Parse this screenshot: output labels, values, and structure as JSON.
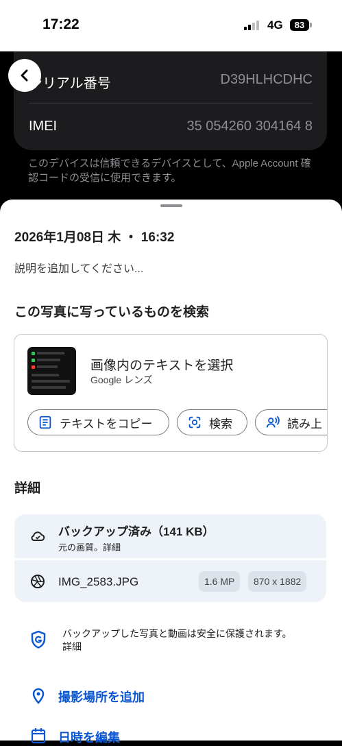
{
  "status_bar": {
    "time": "17:22",
    "network": "4G",
    "battery": "83"
  },
  "background_settings": {
    "rows": [
      {
        "label": "シリアル番号",
        "value": "D39HLHCDHC"
      },
      {
        "label": "IMEI",
        "value": "35 054260 304164 8"
      }
    ],
    "note": "このデバイスは信頼できるデバイスとして、Apple Account 確認コードの受信に使用できます。"
  },
  "sheet": {
    "date": "2026年1月08日 木 ・ 16:32",
    "description_placeholder": "説明を追加してください...",
    "search_heading": "この写真に写っているものを検索",
    "lens": {
      "title": "画像内のテキストを選択",
      "subtitle": "Google レンズ",
      "chips": [
        "テキストをコピー",
        "検索",
        "読み上"
      ]
    },
    "details_heading": "詳細",
    "backup": {
      "title": "バックアップ済み（141 KB）",
      "subtitle": "元の画質。詳細"
    },
    "file": {
      "name": "IMG_2583.JPG",
      "megapixels": "1.6 MP",
      "dimensions": "870 x 1882"
    },
    "security": {
      "text": "バックアップした写真と動画は安全に保護されます。",
      "link": "詳細"
    },
    "actions": {
      "add_location": "撮影場所を追加",
      "edit_datetime": "日時を編集"
    }
  },
  "colors": {
    "accent": "#0b57d0",
    "detail_bg": "#eef2f9",
    "dark_card": "#1c1c1e"
  },
  "icons": [
    "back-chevron-icon",
    "copy-text-icon",
    "lens-search-icon",
    "read-aloud-icon",
    "cloud-done-icon",
    "aperture-icon",
    "shield-g-icon",
    "location-pin-icon",
    "calendar-icon"
  ]
}
